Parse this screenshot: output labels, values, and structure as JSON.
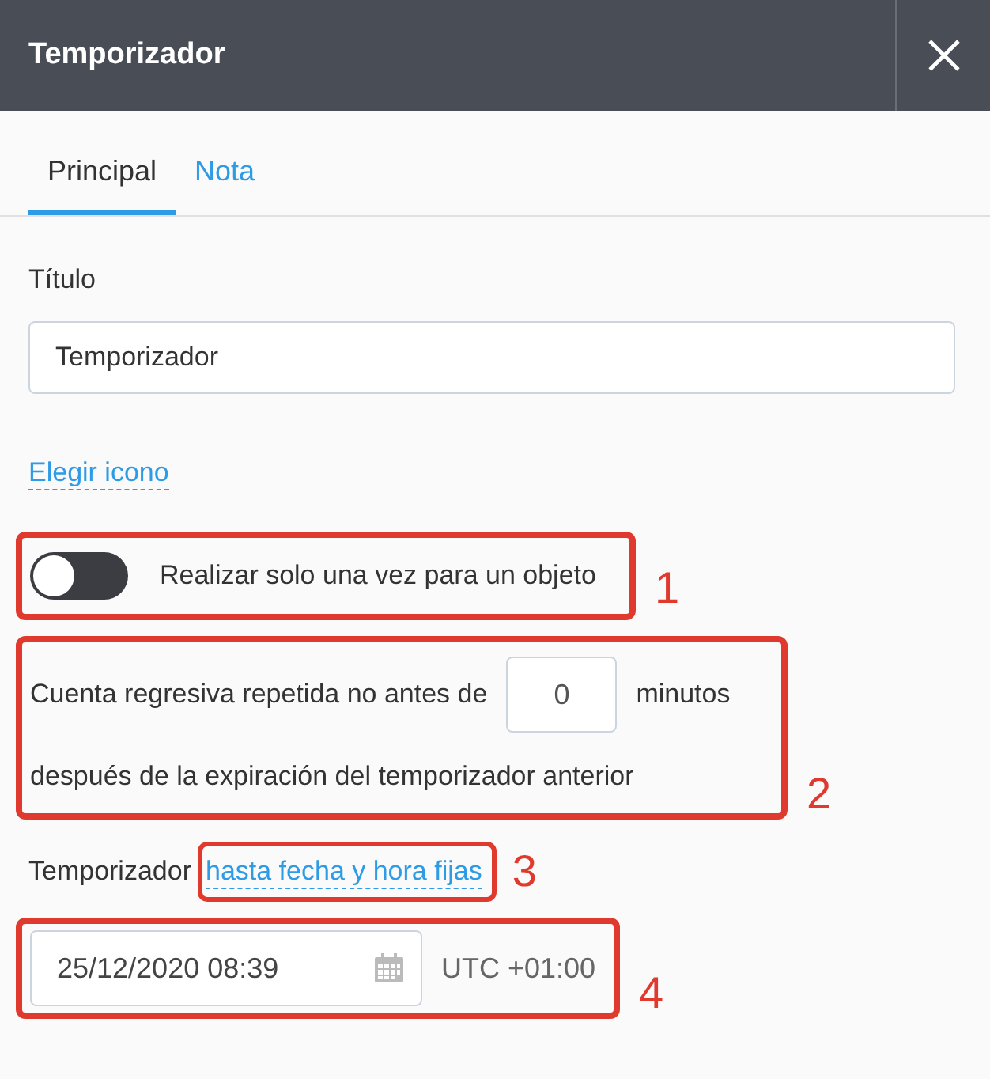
{
  "window": {
    "title": "Temporizador"
  },
  "tabs": [
    {
      "label": "Principal",
      "selected": true
    },
    {
      "label": "Nota",
      "selected": false
    }
  ],
  "title_field": {
    "label": "Título",
    "value": "Temporizador"
  },
  "choose_icon_link": "Elegir icono",
  "once_toggle": {
    "label": "Realizar solo una vez para un objeto",
    "on": false,
    "callout": "1"
  },
  "repeat": {
    "text_before": "Cuenta regresiva repetida no antes de",
    "value": "0",
    "text_after": "minutos",
    "text_line2": "después de la expiración del temporizador anterior",
    "callout": "2"
  },
  "timer_mode": {
    "label": "Temporizador",
    "link": "hasta fecha y hora fijas",
    "callout": "3"
  },
  "datetime": {
    "value": "25/12/2020 08:39",
    "timezone": "UTC +01:00",
    "callout": "4"
  }
}
